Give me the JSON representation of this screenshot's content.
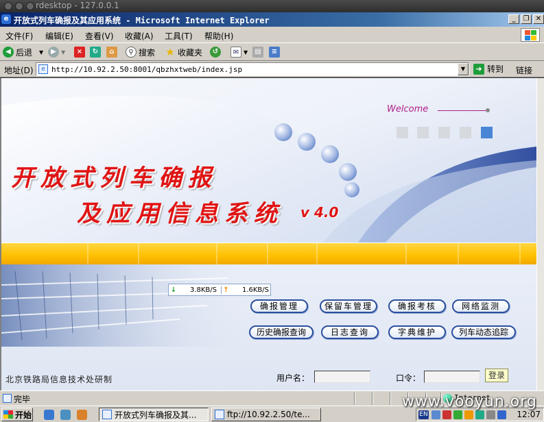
{
  "rdesktop": {
    "title": "rdesktop - 127.0.0.1"
  },
  "window": {
    "title": "开放式列车确报及其应用系统 - Microsoft Internet Explorer",
    "minimize": "_",
    "restore": "❐",
    "close": "✕"
  },
  "menu": [
    "文件(F)",
    "编辑(E)",
    "查看(V)",
    "收藏(A)",
    "工具(T)",
    "帮助(H)"
  ],
  "toolbar": {
    "back": "后退",
    "search": "搜索",
    "favorites": "收藏夹"
  },
  "address": {
    "label": "地址(D)",
    "url": "http://10.92.2.50:8001/qbzhxtweb/index.jsp",
    "go": "转到",
    "links": "链接"
  },
  "banner": {
    "welcome": "Welcome",
    "title_line1": "开放式列车确报",
    "title_line2": "及应用信息系统",
    "version": "v 4.0"
  },
  "netspeed": {
    "down": "3.8KB/S",
    "up": "1.6KB/S"
  },
  "nav_buttons_row1": [
    "确报管理",
    "保留车管理",
    "确报考核",
    "网络监测"
  ],
  "nav_buttons_row2": [
    "历史确报查询",
    "日志查询",
    "字典维护",
    "列车动态追踪"
  ],
  "footer": {
    "org": "北京铁路局信息技术处研制",
    "username_label": "用户名：",
    "password_label": "口令：",
    "login": "登录"
  },
  "status": {
    "text": "完毕",
    "zone": "Internet"
  },
  "taskbar": {
    "start": "开始",
    "tasks": [
      "开放式列车确报及其...",
      "ftp://10.92.2.50/te..."
    ],
    "lang": "EN",
    "clock": "12:07"
  },
  "watermark": "www.vooyun.org",
  "colors": {
    "title_red": "#e01414",
    "welcome_magenta": "#b01d8a",
    "yellow_band": "#ffc000",
    "button_border": "#2b4f9e"
  }
}
